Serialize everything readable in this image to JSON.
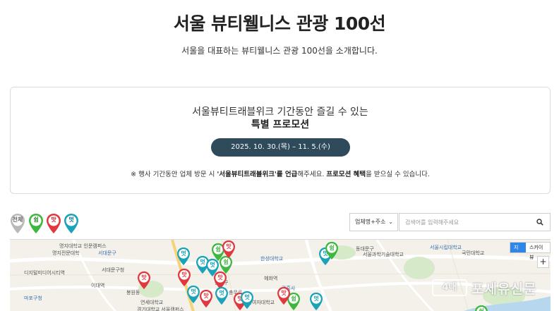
{
  "header": {
    "title": "서울 뷰티웰니스 관광 100선",
    "subtitle": "서울을 대표하는 뷰티웰니스 관광 100선을 소개합니다."
  },
  "promo": {
    "line1": "서울뷰티트래블위크 기간동안 즐길 수 있는",
    "line2": "특별 프로모션",
    "period": "2025. 10. 30.(목) – 11. 5.(수)",
    "note_prefix": "※ 행사 기간동안 업체 방문 시 ",
    "note_bold1": "'서울뷰티트래블위크'를 언급",
    "note_mid": "해주세요. ",
    "note_bold2": "프로모션 혜택",
    "note_suffix": "을 받으실 수 있습니다."
  },
  "filters": [
    {
      "label": "전체",
      "color": "#b9b9b9",
      "text_color": "#666666"
    },
    {
      "label": "쉼",
      "color": "#3db83f",
      "text_color": "#2a8a2c"
    },
    {
      "label": "맛",
      "color": "#e0383e",
      "text_color": "#c02328"
    },
    {
      "label": "멋",
      "color": "#1aa3b8",
      "text_color": "#12798a"
    }
  ],
  "search": {
    "select_value": "업체명+주소",
    "placeholder": "검색어를 입력해주세요"
  },
  "map": {
    "type_map": "지도",
    "type_sky": "스카이뷰",
    "zoom_in": "+",
    "labels": [
      "명지대학교 인문캠퍼스",
      "명지전문대학",
      "서대문구",
      "서대문구청",
      "디지털미디어시티역",
      "이대역",
      "마포구청",
      "봉원동",
      "연세대학교",
      "경기대학교 서울캠퍼스",
      "한성대학교",
      "혜화역",
      "서울과학기술대학교",
      "동대문구",
      "서울시립대학교",
      "충무로",
      "종로구",
      "이화여자대학교",
      "광흥사",
      "국민대학교"
    ],
    "markers": [
      {
        "kind": "멋",
        "color": "#1aa3b8"
      },
      {
        "kind": "쉼",
        "color": "#3db83f"
      },
      {
        "kind": "맛",
        "color": "#e0383e"
      },
      {
        "kind": "멋",
        "color": "#1aa3b8"
      },
      {
        "kind": "맛",
        "color": "#e0383e"
      },
      {
        "kind": "멋",
        "color": "#1aa3b8"
      },
      {
        "kind": "맛",
        "color": "#e0383e"
      },
      {
        "kind": "멋",
        "color": "#1aa3b8"
      },
      {
        "kind": "쉼",
        "color": "#3db83f"
      },
      {
        "kind": "맛",
        "color": "#e0383e"
      },
      {
        "kind": "멋",
        "color": "#1aa3b8"
      },
      {
        "kind": "맛",
        "color": "#e0383e"
      },
      {
        "kind": "멋",
        "color": "#1aa3b8"
      },
      {
        "kind": "쉼",
        "color": "#3db83f"
      },
      {
        "kind": "맛",
        "color": "#e0383e"
      },
      {
        "kind": "멋",
        "color": "#1aa3b8"
      },
      {
        "kind": "맛",
        "color": "#e0383e"
      },
      {
        "kind": "쉼",
        "color": "#3db83f"
      },
      {
        "kind": "멋",
        "color": "#1aa3b8"
      },
      {
        "kind": "쉼",
        "color": "#3db83f"
      }
    ]
  },
  "watermark": {
    "badge": "4대",
    "text": "포세유신문"
  }
}
